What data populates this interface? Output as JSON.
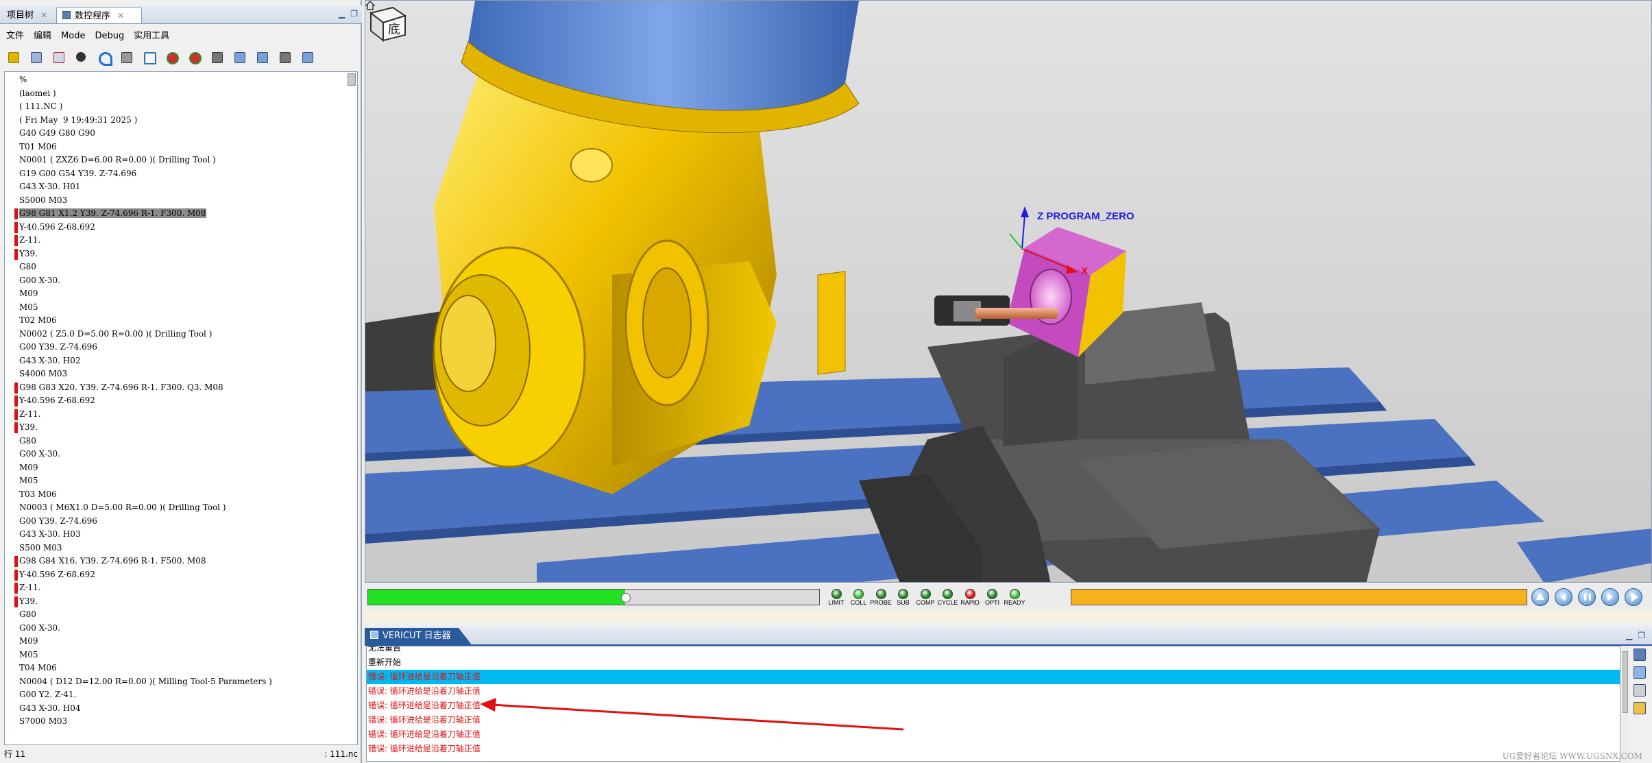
{
  "left_panel": {
    "tabs": [
      {
        "label": "项目树"
      },
      {
        "label": "数控程序"
      }
    ],
    "menu": [
      "文件",
      "编辑",
      "Mode",
      "Debug",
      "实用工具"
    ],
    "code_lines": [
      {
        "text": "%",
        "mark": false,
        "highlight": false
      },
      {
        "text": "(laomei )",
        "mark": false,
        "highlight": false
      },
      {
        "text": "( 111.NC )",
        "mark": false,
        "highlight": false
      },
      {
        "text": "( Fri May  9 19:49:31 2025 )",
        "mark": false,
        "highlight": false
      },
      {
        "text": "G40 G49 G80 G90",
        "mark": false,
        "highlight": false
      },
      {
        "text": "T01 M06",
        "mark": false,
        "highlight": false
      },
      {
        "text": "N0001 ( ZXZ6 D=6.00 R=0.00 )( Drilling Tool )",
        "mark": false,
        "highlight": false
      },
      {
        "text": "G19 G00 G54 Y39. Z-74.696",
        "mark": false,
        "highlight": false
      },
      {
        "text": "G43 X-30. H01",
        "mark": false,
        "highlight": false
      },
      {
        "text": "S5000 M03",
        "mark": false,
        "highlight": false
      },
      {
        "text": "G98 G81 X1.2 Y39. Z-74.696 R-1. F300. M08",
        "mark": true,
        "highlight": true
      },
      {
        "text": "Y-40.596 Z-68.692",
        "mark": true,
        "highlight": false
      },
      {
        "text": "Z-11.",
        "mark": true,
        "highlight": false
      },
      {
        "text": "Y39.",
        "mark": true,
        "highlight": false
      },
      {
        "text": "G80",
        "mark": false,
        "highlight": false
      },
      {
        "text": "G00 X-30.",
        "mark": false,
        "highlight": false
      },
      {
        "text": "M09",
        "mark": false,
        "highlight": false
      },
      {
        "text": "M05",
        "mark": false,
        "highlight": false
      },
      {
        "text": "T02 M06",
        "mark": false,
        "highlight": false
      },
      {
        "text": "N0002 ( Z5.0 D=5.00 R=0.00 )( Drilling Tool )",
        "mark": false,
        "highlight": false
      },
      {
        "text": "G00 Y39. Z-74.696",
        "mark": false,
        "highlight": false
      },
      {
        "text": "G43 X-30. H02",
        "mark": false,
        "highlight": false
      },
      {
        "text": "S4000 M03",
        "mark": false,
        "highlight": false
      },
      {
        "text": "G98 G83 X20. Y39. Z-74.696 R-1. F300. Q3. M08",
        "mark": true,
        "highlight": false
      },
      {
        "text": "Y-40.596 Z-68.692",
        "mark": true,
        "highlight": false
      },
      {
        "text": "Z-11.",
        "mark": true,
        "highlight": false
      },
      {
        "text": "Y39.",
        "mark": true,
        "highlight": false
      },
      {
        "text": "G80",
        "mark": false,
        "highlight": false
      },
      {
        "text": "G00 X-30.",
        "mark": false,
        "highlight": false
      },
      {
        "text": "M09",
        "mark": false,
        "highlight": false
      },
      {
        "text": "M05",
        "mark": false,
        "highlight": false
      },
      {
        "text": "T03 M06",
        "mark": false,
        "highlight": false
      },
      {
        "text": "N0003 ( M6X1.0 D=5.00 R=0.00 )( Drilling Tool )",
        "mark": false,
        "highlight": false
      },
      {
        "text": "G00 Y39. Z-74.696",
        "mark": false,
        "highlight": false
      },
      {
        "text": "G43 X-30. H03",
        "mark": false,
        "highlight": false
      },
      {
        "text": "S500 M03",
        "mark": false,
        "highlight": false
      },
      {
        "text": "G98 G84 X16. Y39. Z-74.696 R-1. F500. M08",
        "mark": true,
        "highlight": false
      },
      {
        "text": "Y-40.596 Z-68.692",
        "mark": true,
        "highlight": false
      },
      {
        "text": "Z-11.",
        "mark": true,
        "highlight": false
      },
      {
        "text": "Y39.",
        "mark": true,
        "highlight": false
      },
      {
        "text": "G80",
        "mark": false,
        "highlight": false
      },
      {
        "text": "G00 X-30.",
        "mark": false,
        "highlight": false
      },
      {
        "text": "M09",
        "mark": false,
        "highlight": false
      },
      {
        "text": "M05",
        "mark": false,
        "highlight": false
      },
      {
        "text": "T04 M06",
        "mark": false,
        "highlight": false
      },
      {
        "text": "N0004 ( D12 D=12.00 R=0.00 )( Milling Tool-5 Parameters )",
        "mark": false,
        "highlight": false
      },
      {
        "text": "G00 Y2. Z-41.",
        "mark": false,
        "highlight": false
      },
      {
        "text": "G43 X-30. H04",
        "mark": false,
        "highlight": false
      },
      {
        "text": "S7000 M03",
        "mark": false,
        "highlight": false
      }
    ],
    "status_left": "行 11",
    "status_right": ": 111.nc"
  },
  "viewport": {
    "program_zero_label": "Z PROGRAM_ZERO",
    "x_axis_label": "X",
    "view_cube_face": "底",
    "colors": {
      "spindle_head": "#f2c200",
      "housing_blue": "#4f7fd0",
      "table_blue": "#4a72c0",
      "vise_gray": "#4c4c4c",
      "tool_copper": "#e0895a",
      "workpiece_magenta": "#c44ac0"
    }
  },
  "playback": {
    "progress": 0.57,
    "leds": [
      {
        "label": "LIMIT",
        "color": "#1f8a1f"
      },
      {
        "label": "COLL",
        "color": "#34c234"
      },
      {
        "label": "PROBE",
        "color": "#1f8a1f"
      },
      {
        "label": "SUB",
        "color": "#1f8a1f"
      },
      {
        "label": "COMP",
        "color": "#1f8a1f"
      },
      {
        "label": "CYCLE",
        "color": "#1f8a1f"
      },
      {
        "label": "RAPID",
        "color": "#e01818"
      },
      {
        "label": "OPTI",
        "color": "#1f8a1f"
      },
      {
        "label": "READY",
        "color": "#34c234"
      }
    ],
    "transport_buttons": [
      "reset",
      "rewind",
      "stop",
      "step",
      "play"
    ]
  },
  "logger": {
    "tab_label": "VERICUT 日志器",
    "lines": [
      {
        "text": "无法重置",
        "type": "info",
        "selected": false
      },
      {
        "text": "重新开始",
        "type": "info",
        "selected": false
      },
      {
        "text": "错误: 循环进给是沿着刀轴正值",
        "type": "error",
        "selected": true
      },
      {
        "text": "错误: 循环进给是沿着刀轴正值",
        "type": "error",
        "selected": false
      },
      {
        "text": "错误: 循环进给是沿着刀轴正值",
        "type": "error",
        "selected": false
      },
      {
        "text": "错误: 循环进给是沿着刀轴正值",
        "type": "error",
        "selected": false
      },
      {
        "text": "错误: 循环进给是沿着刀轴正值",
        "type": "error",
        "selected": false
      },
      {
        "text": "错误: 循环进给是沿着刀轴正值",
        "type": "error",
        "selected": false
      }
    ]
  },
  "watermark": "UG爱好者论坛 WWW.UGSNX.COM"
}
